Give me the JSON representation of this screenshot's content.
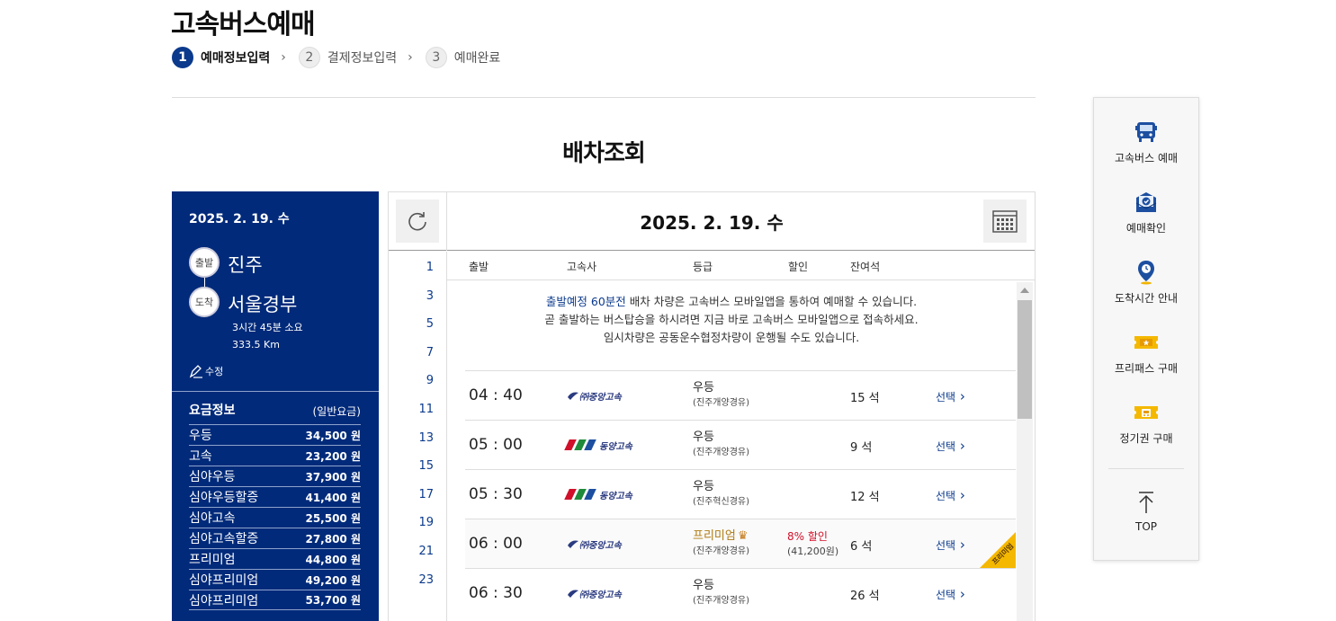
{
  "page": {
    "title": "고속버스예매"
  },
  "steps": [
    {
      "num": "1",
      "label": "예매정보입력"
    },
    {
      "num": "2",
      "label": "결제정보입력"
    },
    {
      "num": "3",
      "label": "예매완료"
    }
  ],
  "section_title": "배차조회",
  "trip": {
    "date": "2025. 2. 19. 수",
    "dep_badge": "출발",
    "dep_city": "진주",
    "arr_badge": "도착",
    "arr_city": "서울경부",
    "duration": "3시간 45분 소요",
    "distance": "333.5 Km",
    "edit_label": "수정"
  },
  "fares": {
    "header": "요금정보",
    "sub": "(일반요금)",
    "items": [
      {
        "grade": "우등",
        "price": "34,500 원"
      },
      {
        "grade": "고속",
        "price": "23,200 원"
      },
      {
        "grade": "심야우등",
        "price": "37,900 원"
      },
      {
        "grade": "심야우등할증",
        "price": "41,400 원"
      },
      {
        "grade": "심야고속",
        "price": "25,500 원"
      },
      {
        "grade": "심야고속할증",
        "price": "27,800 원"
      },
      {
        "grade": "프리미엄",
        "price": "44,800 원"
      },
      {
        "grade": "심야프리미엄",
        "price": "49,200 원"
      },
      {
        "grade": "심야프리미엄",
        "price": "53,700 원"
      }
    ]
  },
  "schedule": {
    "date": "2025. 2. 19. 수",
    "hours": [
      "1",
      "3",
      "5",
      "7",
      "9",
      "11",
      "13",
      "15",
      "17",
      "19",
      "21",
      "23"
    ],
    "columns": {
      "dep": "출발",
      "company": "고속사",
      "grade": "등급",
      "discount": "할인",
      "seats": "잔여석"
    },
    "notice": {
      "hl": "출발예정 60분전",
      "line1": " 배차 차량은 고속버스 모바일앱을 통하여 예매할 수 있습니다.",
      "line2": "곧 출발하는 버스탑승을 하시려면 지금 바로 고속버스 모바일앱으로 접속하세요.",
      "line3": "임시차량은 공동운수협정차량이 운행될 수도 있습니다."
    },
    "rows": [
      {
        "time": "04 : 40",
        "company": "㈜중앙고속",
        "grade": "우등",
        "via": "(진주개양경유)",
        "discount_rate": "",
        "discount_price": "",
        "seats": "15 석",
        "select": "선택"
      },
      {
        "time": "05 : 00",
        "company": "동양고속",
        "grade": "우등",
        "via": "(진주개양경유)",
        "discount_rate": "",
        "discount_price": "",
        "seats": "9 석",
        "select": "선택"
      },
      {
        "time": "05 : 30",
        "company": "동양고속",
        "grade": "우등",
        "via": "(진주혁신경유)",
        "discount_rate": "",
        "discount_price": "",
        "seats": "12 석",
        "select": "선택"
      },
      {
        "time": "06 : 00",
        "company": "㈜중앙고속",
        "grade": "프리미엄",
        "via": "(진주개양경유)",
        "discount_rate": "8% 할인",
        "discount_price": "(41,200원)",
        "seats": "6 석",
        "select": "선택",
        "ribbon": "프리미엄"
      },
      {
        "time": "06 : 30",
        "company": "㈜중앙고속",
        "grade": "우등",
        "via": "(진주개양경유)",
        "discount_rate": "",
        "discount_price": "",
        "seats": "26 석",
        "select": "선택"
      }
    ]
  },
  "side_menu": [
    {
      "label": "고속버스 예매",
      "icon": "bus-icon"
    },
    {
      "label": "예매확인",
      "icon": "ticket-check-icon"
    },
    {
      "label": "도착시간 안내",
      "icon": "location-pin-icon"
    },
    {
      "label": "프리패스 구매",
      "icon": "freepass-icon"
    },
    {
      "label": "정기권 구매",
      "icon": "season-ticket-icon"
    },
    {
      "label": "TOP",
      "icon": "arrow-up-icon"
    }
  ],
  "colors": {
    "brand_navy": "#012a7a",
    "accent_blue": "#0b3a8c",
    "discount_red": "#d0102a",
    "premium_gold": "#f5b800"
  }
}
